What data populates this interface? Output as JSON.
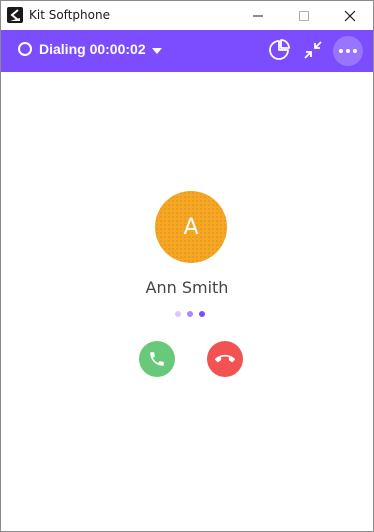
{
  "window": {
    "title": "Kit Softphone",
    "logo_icon": "kit-logo-icon"
  },
  "header": {
    "status_label": "Dialing",
    "timer": "00:00:02",
    "accent_color": "#7c4dff",
    "icons": [
      "status-circle-icon",
      "chevron-down-icon",
      "pie-chart-icon",
      "collapse-icon",
      "more-horizontal-icon"
    ]
  },
  "call": {
    "avatar_initial": "A",
    "avatar_color": "#f5a623",
    "contact_name": "Ann Smith",
    "answer_icon": "phone-icon",
    "answer_color": "#69c97a",
    "hangup_icon": "phone-hangup-icon",
    "hangup_color": "#f25252"
  }
}
